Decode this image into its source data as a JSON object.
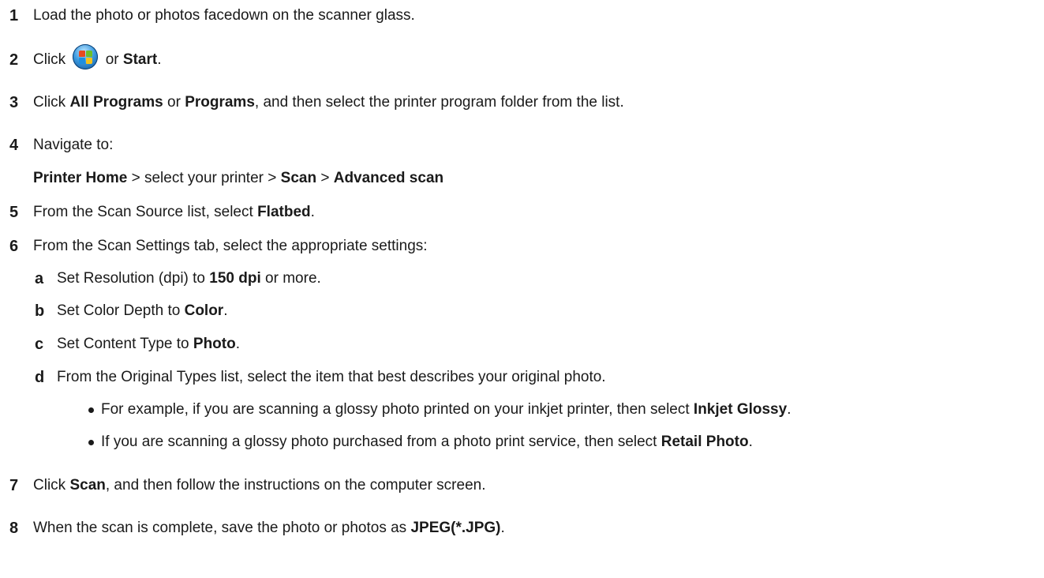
{
  "steps": {
    "s1": {
      "num": "1",
      "text": "Load the photo or photos facedown on the scanner glass."
    },
    "s2": {
      "num": "2",
      "pre": "Click",
      "mid": "or",
      "bold": "Start",
      "post": "."
    },
    "s3": {
      "num": "3",
      "pre": "Click",
      "bold1": "All Programs",
      "mid": "or",
      "bold2": "Programs",
      "post": ", and then select the printer program folder from the list."
    },
    "s4": {
      "num": "4",
      "text": "Navigate to:",
      "path": {
        "b1": "Printer Home",
        "t1": " > select your printer > ",
        "b2": "Scan",
        "t2": " > ",
        "b3": "Advanced scan"
      }
    },
    "s5": {
      "num": "5",
      "pre": "From the Scan Source list, select",
      "bold": "Flatbed",
      "post": "."
    },
    "s6": {
      "num": "6",
      "text": "From the Scan Settings tab, select the appropriate settings:",
      "a": {
        "letter": "a",
        "pre": "Set Resolution (dpi) to",
        "bold": "150 dpi",
        "post": "or more."
      },
      "b": {
        "letter": "b",
        "pre": "Set Color Depth to",
        "bold": "Color",
        "post": "."
      },
      "c": {
        "letter": "c",
        "pre": "Set Content Type to",
        "bold": "Photo",
        "post": "."
      },
      "d": {
        "letter": "d",
        "text": "From the Original Types list, select the item that best describes your original photo.",
        "bullet1": {
          "pre": "For example, if you are scanning a glossy photo printed on your inkjet printer, then select",
          "bold": "Inkjet Glossy",
          "post": "."
        },
        "bullet2": {
          "pre": "If you are scanning a glossy photo purchased from a photo print service, then select",
          "bold": "Retail Photo",
          "post": "."
        }
      }
    },
    "s7": {
      "num": "7",
      "pre": "Click",
      "bold": "Scan",
      "post": ", and then follow the instructions on the computer screen."
    },
    "s8": {
      "num": "8",
      "pre": "When the scan is complete, save the photo or photos as",
      "bold": "JPEG(*.JPG)",
      "post": "."
    }
  },
  "icons": {
    "start_button": "windows-start-orb-icon"
  }
}
